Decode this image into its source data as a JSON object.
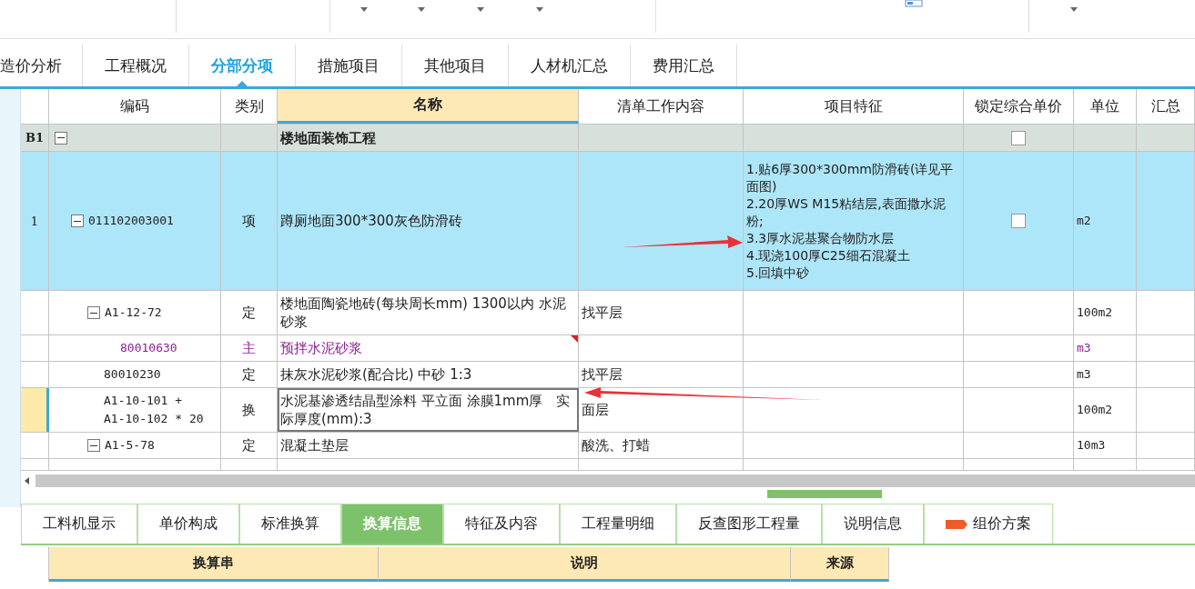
{
  "main_tabs": [
    {
      "label": "造价分析",
      "selected": false
    },
    {
      "label": "工程概况",
      "selected": false
    },
    {
      "label": "分部分项",
      "selected": true
    },
    {
      "label": "措施项目",
      "selected": false
    },
    {
      "label": "其他项目",
      "selected": false
    },
    {
      "label": "人材机汇总",
      "selected": false
    },
    {
      "label": "费用汇总",
      "selected": false
    }
  ],
  "table": {
    "columns": [
      "编码",
      "类别",
      "名称",
      "清单工作内容",
      "项目特征",
      "锁定综合单价",
      "单位",
      "汇总"
    ],
    "rows": [
      {
        "kind": "section",
        "num": "B1",
        "name": "楼地面装饰工程",
        "locked": false,
        "expanded": true,
        "selected": false,
        "focused": false,
        "children": [
          {
            "kind": "item",
            "num": "1",
            "code": "011102003001",
            "type": "项",
            "name": "蹲厕地面300*300灰色防滑砖",
            "feature": "1.贴6厚300*300mm防滑砖(详见平面图)\n2.20厚WS M15粘结层,表面撒水泥粉;\n3.3厚水泥基聚合物防水层\n4.现浇100厚C25细石混凝土\n5.回填中砂",
            "locked": false,
            "unit": "m2",
            "expanded": true,
            "selected": true,
            "focused": false,
            "children": [
              {
                "kind": "quota",
                "code": "A1-12-72",
                "type": "定",
                "name": "楼地面陶瓷地砖(每块周长mm) 1300以内 水泥砂浆",
                "content": "找平层",
                "unit": "100m2",
                "expanded": true,
                "selected": false,
                "focused": false,
                "children": [
                  {
                    "kind": "material",
                    "code": "80010630",
                    "type": "主",
                    "name": "预拌水泥砂浆",
                    "unit": "m3",
                    "selected": false,
                    "focused": false
                  }
                ]
              },
              {
                "kind": "quota",
                "code": "80010230",
                "type": "定",
                "name": "抹灰水泥砂浆(配合比) 中砂 1:3",
                "content": "找平层",
                "unit": "m3",
                "selected": false,
                "focused": false
              },
              {
                "kind": "quota",
                "code": "A1-10-101 +\nA1-10-102 * 20",
                "type": "换",
                "name": "水泥基渗透结晶型涂料 平立面 涂膜1mm厚　实际厚度(mm):3",
                "content": "面层",
                "unit": "100m2",
                "selected": false,
                "focused": true
              },
              {
                "kind": "quota",
                "code": "A1-5-78",
                "type": "定",
                "name": "混凝土垫层",
                "content": "酸洗、打蜡",
                "unit": "10m3",
                "expanded": true,
                "selected": false,
                "focused": false
              }
            ]
          }
        ]
      }
    ]
  },
  "bottom_tabs": [
    {
      "label": "工料机显示",
      "selected": false
    },
    {
      "label": "单价构成",
      "selected": false
    },
    {
      "label": "标准换算",
      "selected": false
    },
    {
      "label": "换算信息",
      "selected": true
    },
    {
      "label": "特征及内容",
      "selected": false
    },
    {
      "label": "工程量明细",
      "selected": false
    },
    {
      "label": "反查图形工程量",
      "selected": false
    },
    {
      "label": "说明信息",
      "selected": false
    },
    {
      "label": "组价方案",
      "selected": false,
      "badge": true
    }
  ],
  "bottom_table": {
    "columns": [
      "换算串",
      "说明",
      "来源"
    ]
  }
}
